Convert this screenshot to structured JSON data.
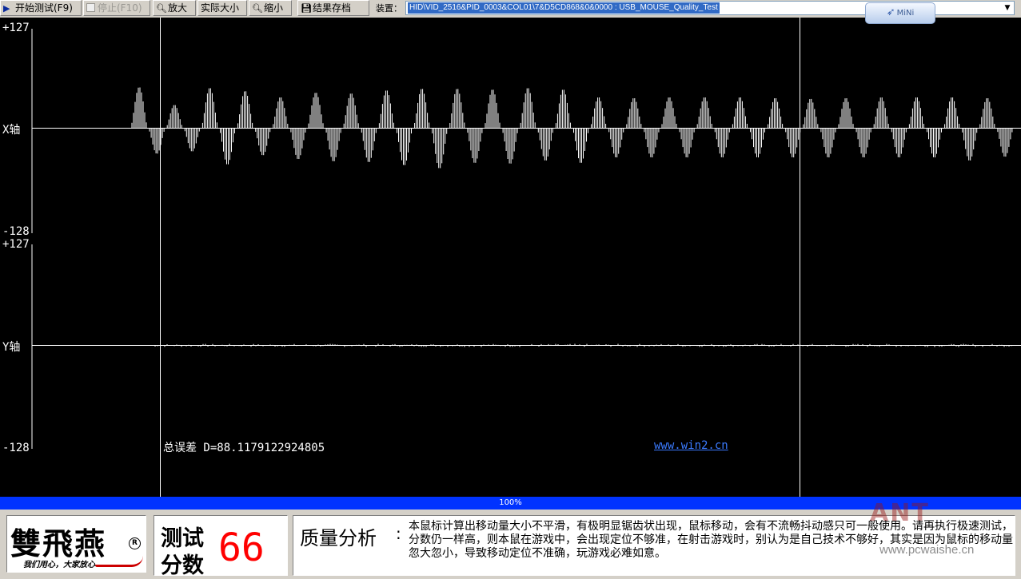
{
  "toolbar": {
    "start_label": "开始测试(F9)",
    "stop_label": "停止(F10)",
    "zoom_in_label": "放大",
    "actual_size_label": "实际大小",
    "zoom_out_label": "缩小",
    "save_label": "结果存档",
    "device_label": "装置：",
    "device_value": "HID\\VID_2516&PID_0003&COL01\\7&D5CD868&0&0000 : USB_MOUSE_Quality_Test",
    "mini_label": "MiNi"
  },
  "chart_data": {
    "type": "line",
    "x_axis": {
      "label": "X轴",
      "ymax_label": "+127",
      "ymin_label": "-128",
      "ylim": [
        -128,
        127
      ]
    },
    "y_axis": {
      "label": "Y轴",
      "ymax_label": "+127",
      "ymin_label": "-128",
      "ylim": [
        -128,
        127
      ]
    },
    "x_peaks": [
      {
        "sign": 1,
        "amp": 53
      },
      {
        "sign": -1,
        "amp": 33
      },
      {
        "sign": 1,
        "amp": 30
      },
      {
        "sign": -1,
        "amp": 30
      },
      {
        "sign": 1,
        "amp": 52
      },
      {
        "sign": -1,
        "amp": 47
      },
      {
        "sign": 1,
        "amp": 48
      },
      {
        "sign": -1,
        "amp": 35
      },
      {
        "sign": 1,
        "amp": 40
      },
      {
        "sign": -1,
        "amp": 40
      },
      {
        "sign": 1,
        "amp": 46
      },
      {
        "sign": -1,
        "amp": 43
      },
      {
        "sign": 1,
        "amp": 45
      },
      {
        "sign": -1,
        "amp": 44
      },
      {
        "sign": 1,
        "amp": 49
      },
      {
        "sign": -1,
        "amp": 48
      },
      {
        "sign": 1,
        "amp": 51
      },
      {
        "sign": -1,
        "amp": 52
      },
      {
        "sign": 1,
        "amp": 51
      },
      {
        "sign": -1,
        "amp": 45
      },
      {
        "sign": 1,
        "amp": 50
      },
      {
        "sign": -1,
        "amp": 46
      },
      {
        "sign": 1,
        "amp": 52
      },
      {
        "sign": -1,
        "amp": 42
      },
      {
        "sign": 1,
        "amp": 50
      },
      {
        "sign": -1,
        "amp": 45
      },
      {
        "sign": 1,
        "amp": 40
      },
      {
        "sign": -1,
        "amp": 38
      },
      {
        "sign": 1,
        "amp": 39
      },
      {
        "sign": -1,
        "amp": 38
      },
      {
        "sign": 1,
        "amp": 40
      },
      {
        "sign": -1,
        "amp": 38
      },
      {
        "sign": 1,
        "amp": 40
      },
      {
        "sign": -1,
        "amp": 38
      },
      {
        "sign": 1,
        "amp": 40
      },
      {
        "sign": -1,
        "amp": 38
      },
      {
        "sign": 1,
        "amp": 39
      },
      {
        "sign": -1,
        "amp": 38
      },
      {
        "sign": 1,
        "amp": 38
      },
      {
        "sign": -1,
        "amp": 38
      },
      {
        "sign": 1,
        "amp": 39
      },
      {
        "sign": -1,
        "amp": 38
      },
      {
        "sign": 1,
        "amp": 40
      },
      {
        "sign": -1,
        "amp": 38
      },
      {
        "sign": 1,
        "amp": 40
      },
      {
        "sign": -1,
        "amp": 38
      },
      {
        "sign": 1,
        "amp": 40
      },
      {
        "sign": -1,
        "amp": 42
      },
      {
        "sign": 1,
        "amp": 39
      },
      {
        "sign": -1,
        "amp": 37
      }
    ],
    "y_noise_amp": 2,
    "grid": false
  },
  "plot": {
    "total_error_text": "总误差 D=88.1179122924805",
    "site_link": "www.win2.cn"
  },
  "progress": {
    "value": 1.0,
    "text": "100%"
  },
  "result": {
    "logo_text": "雙飛燕",
    "logo_slogan": "我们用心，大家放心",
    "score_label_1": "测试",
    "score_label_2": "分数",
    "score_value": "66",
    "analysis_title": "质量分析",
    "analysis_colon": ":",
    "analysis_text": "本鼠标计算出移动量大小不平滑，有极明显锯齿状出现，鼠标移动，会有不流畅抖动感只可一般使用。请再执行极速测试，分数仍一样高，则本鼠在游戏中，会出现定位不够准，在射击游戏时，别认为是自己技术不够好，其实是因为鼠标的移动量忽大忽小，导致移动定位不准确，玩游戏必难如意。"
  },
  "watermark": {
    "text": "www.pcwaishe.cn"
  },
  "colors": {
    "plot_bg": "#000000",
    "trace": "#ffffff",
    "progress": "#0033ff",
    "score": "#ff0000",
    "link": "#3b7bff"
  }
}
